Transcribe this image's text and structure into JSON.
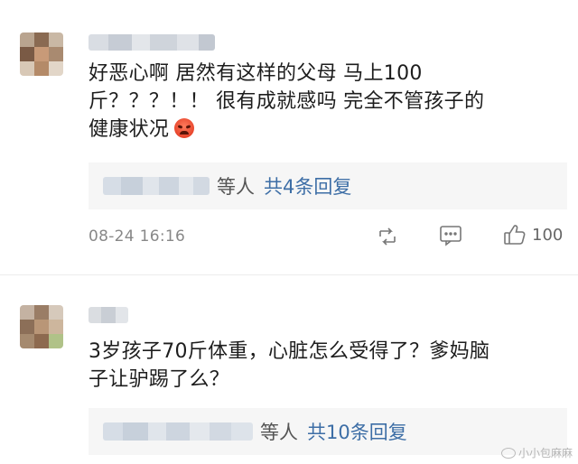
{
  "comments": [
    {
      "line1": "好恶心啊 居然有这样的父母 马上100",
      "line2": "斤？？？！！ 很有成就感吗 完全不管孩子的",
      "line3": "健康状况",
      "emoji": "angry-face-emoji",
      "reply_suffix": "等人",
      "reply_count": "共4条回复",
      "time": "08-24 16:16",
      "like_count": "100"
    },
    {
      "line1": "3岁孩子70斤体重，心脏怎么受得了？爹妈脑",
      "line2": "子让驴踢了么？",
      "reply_suffix": "等人",
      "reply_count": "共10条回复"
    }
  ],
  "icons": {
    "share": "share-icon",
    "comment": "comment-icon",
    "like": "thumbs-up-icon"
  },
  "watermark": {
    "text": "小小包麻麻",
    "icon": "wechat-icon"
  }
}
